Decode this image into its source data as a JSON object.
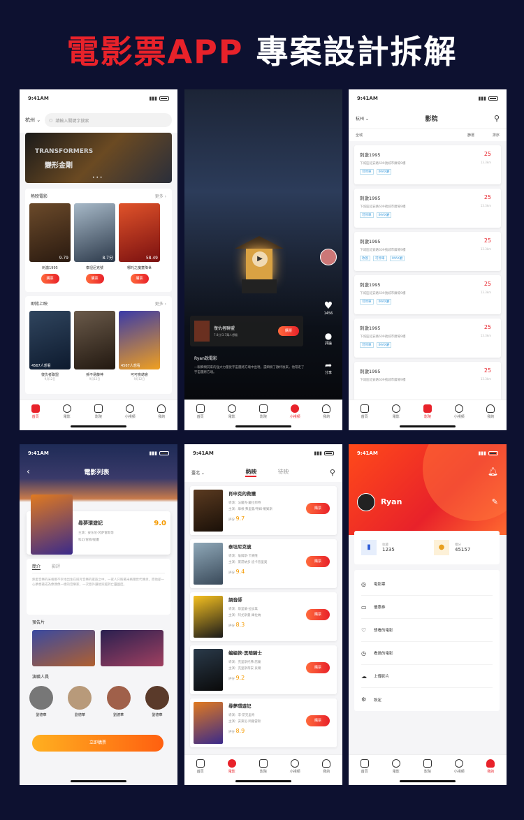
{
  "page_title": {
    "part1": "電影票APP",
    "part2": " 專案設計拆解"
  },
  "status_time": "9:41AM",
  "status_time_short": "9:41AM",
  "p1": {
    "city": "杭州",
    "search_placeholder": "請輸入關鍵字搜索",
    "banner_title": "TRANSFORMERS",
    "banner_sub": "變形金剛",
    "hot_label": "熱映電影",
    "more": "更多 ›",
    "hot": [
      {
        "name": "刺激1995",
        "score": "9.79"
      },
      {
        "name": "泰坦尼克號",
        "score": "8.7分"
      },
      {
        "name": "哪吒之魔童降世",
        "score": "58.49"
      }
    ],
    "buy": "購票",
    "soon_label": "即將上映",
    "soon": [
      {
        "name": "復仇者聯盟",
        "date": "9月12日",
        "count": "4567人想看"
      },
      {
        "name": "孫不易藤神",
        "date": "9月12日",
        "count": ""
      },
      {
        "name": "可可夜總會",
        "date": "9月12日",
        "count": "4567人想看"
      }
    ],
    "tabs": [
      "首頁",
      "電影",
      "影院",
      "小視頻",
      "我的"
    ]
  },
  "p2": {
    "movie": "復仇者聯盟",
    "movie_sub": "7.8分/3.7萬人想看",
    "buy": "購票",
    "likes": "1456",
    "comment": "評論",
    "share": "分享",
    "author": "Ryan說電影",
    "desc": "一眼瞬間其來的強大力量從宇宙團將方塊中出現，還瞬將了數杯後來，他帶走了宇宙團將方塊。",
    "tabs": [
      "首頁",
      "電影",
      "影院",
      "小視頻",
      "我的"
    ]
  },
  "p3": {
    "city": "杭州",
    "title": "影院",
    "filter1": "全城",
    "filter2": "篩選",
    "filter3": "排序",
    "cinemas": [
      {
        "name": "刺激1995",
        "addr": "下城區延安路609號城市廣場9樓",
        "dist": "13.3km",
        "price": "25",
        "tags": [
          "可停車",
          "IMAX廳"
        ]
      },
      {
        "name": "刺激1995",
        "addr": "下城區延安路609號城市廣場9樓",
        "dist": "13.3km",
        "price": "25",
        "tags": [
          "可停車",
          "IMAX廳"
        ]
      },
      {
        "name": "刺激1995",
        "addr": "下城區延安路609號城市廣場9樓",
        "dist": "13.3km",
        "price": "25",
        "tags": [
          "改簽",
          "可停車",
          "IMAX廳"
        ]
      },
      {
        "name": "刺激1995",
        "addr": "下城區延安路609號城市廣場9樓",
        "dist": "13.3km",
        "price": "25",
        "tags": [
          "可停車",
          "IMAX廳"
        ]
      },
      {
        "name": "刺激1995",
        "addr": "下城區延安路609號城市廣場9樓",
        "dist": "13.3km",
        "price": "25",
        "tags": [
          "可停車",
          "IMAX廳"
        ]
      },
      {
        "name": "刺激1995",
        "addr": "下城區延安路609號城市廣場9樓",
        "dist": "13.3km",
        "price": "25",
        "tags": []
      }
    ],
    "tabs": [
      "首頁",
      "電影",
      "影院",
      "小視頻",
      "我的"
    ]
  },
  "p4": {
    "title": "電影列表",
    "movie": "尋夢環遊記",
    "score": "9.0",
    "meta1": "主演：安东尼·冈萨雷斯等",
    "meta2": "科幻/冒險/動畫",
    "tab1": "簡介",
    "tab2": "影評",
    "desc": "熱愛音樂的米格爾不幸地出生在排斥音樂的家族之中，一家人只盼著米格爾世代傳承，而他卻一心夢想著成為像偶像一樣的音樂家，一次意外讓他穿越到亡靈國度。",
    "trailer": "預告片",
    "cast": "演職人員",
    "actors": [
      "劉德華",
      "劉德華",
      "劉德華",
      "劉德華"
    ],
    "btn": "立即購票"
  },
  "p5": {
    "city": "臺北",
    "tab1": "熱映",
    "tab2": "待映",
    "buy": "購票",
    "label": "評分",
    "movies": [
      {
        "name": "肖申克的救贖",
        "dir": "導演：法蘭克·戴拉邦特",
        "cast": "主演：摩根·弗里曼/蒂姆·羅賓斯",
        "score": "9.7"
      },
      {
        "name": "泰坦尼克號",
        "dir": "導演：詹姆斯·卡麥隆",
        "cast": "主演：萊昂納多·迪卡普里奧",
        "score": "9.4"
      },
      {
        "name": "調音師",
        "dir": "導演：斯里蘭·拉加萬",
        "cast": "主演：阿尤斯曼·庫拉納",
        "score": "8.3"
      },
      {
        "name": "蝙蝠俠·黑暗騎士",
        "dir": "導演：克里斯托弗·諾蘭",
        "cast": "主演：克里斯蒂安·貝爾",
        "score": "9.2"
      },
      {
        "name": "尋夢環遊記",
        "dir": "導演：李·昂克里奇",
        "cast": "主演：安東尼·岡薩雷斯",
        "score": "8.9"
      }
    ],
    "tabs": [
      "首頁",
      "電影",
      "影院",
      "小視頻",
      "我的"
    ]
  },
  "p6": {
    "name": "Ryan",
    "stat1_label": "收藏",
    "stat1": "1235",
    "stat2_label": "積分",
    "stat2": "45157",
    "menu": [
      "電影票",
      "優惠券",
      "想看的電影",
      "看過的電影",
      "上傳影片",
      "設定"
    ],
    "tabs": [
      "首頁",
      "電影",
      "影院",
      "小視頻",
      "我的"
    ]
  }
}
